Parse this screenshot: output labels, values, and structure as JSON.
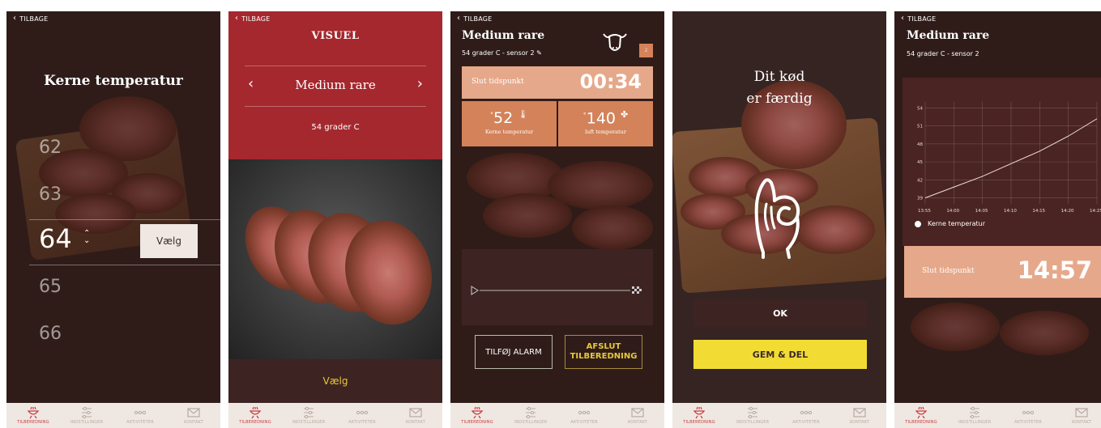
{
  "nav": {
    "back_label": "TILBAGE",
    "tabs": [
      "TILBEREDNING",
      "INDSTILLINGER",
      "AKTIVITETER",
      "KONTAKT"
    ]
  },
  "screen1": {
    "title": "Kerne temperatur",
    "values": [
      "62",
      "63",
      "64",
      "65",
      "66"
    ],
    "selected": "64",
    "button": "Vælg"
  },
  "screen2": {
    "title": "VISUEL",
    "selection": "Medium rare",
    "subtitle": "54 grader C",
    "button": "Vælg"
  },
  "screen3": {
    "title": "Medium rare",
    "subtitle": "54 grader C - sensor 2",
    "badge": "2",
    "slut_label": "Slut tidspunkt",
    "slut_time": "00:34",
    "core_temp": "52",
    "core_label": "Kerne temperatur",
    "air_temp": "140",
    "air_label": "luft temperatur",
    "degree": "°",
    "btn_alarm": "TILFØJ ALARM",
    "btn_finish_1": "AFSLUT",
    "btn_finish_2": "TILBEREDNING"
  },
  "screen4": {
    "title_line1": "Dit kød",
    "title_line2": "er færdig",
    "ok": "OK",
    "share": "GEM & DEL"
  },
  "screen5": {
    "title": "Medium rare",
    "subtitle": "54 grader C - sensor 2",
    "legend": "Kerne temperatur",
    "slut_label": "Slut tidspunkt",
    "slut_time": "14:57"
  },
  "colors": {
    "brand_red": "#a5282e",
    "peach": "#e6a88a",
    "orange": "#d4825a",
    "yellow": "#f2dc34",
    "dark_brown": "#3d2422"
  },
  "chart_data": {
    "type": "line",
    "x": [
      "13:55",
      "14:00",
      "14:05",
      "14:10",
      "14:15",
      "14:20",
      "14:25"
    ],
    "y_ticks": [
      "54",
      "51",
      "48",
      "45",
      "42",
      "39"
    ],
    "series": [
      {
        "values": [
          39,
          40.8,
          42.6,
          44.7,
          46.8,
          49.3,
          52.2
        ]
      }
    ],
    "ylim": [
      38,
      55
    ],
    "grid": true,
    "legend": "bottom-left"
  }
}
